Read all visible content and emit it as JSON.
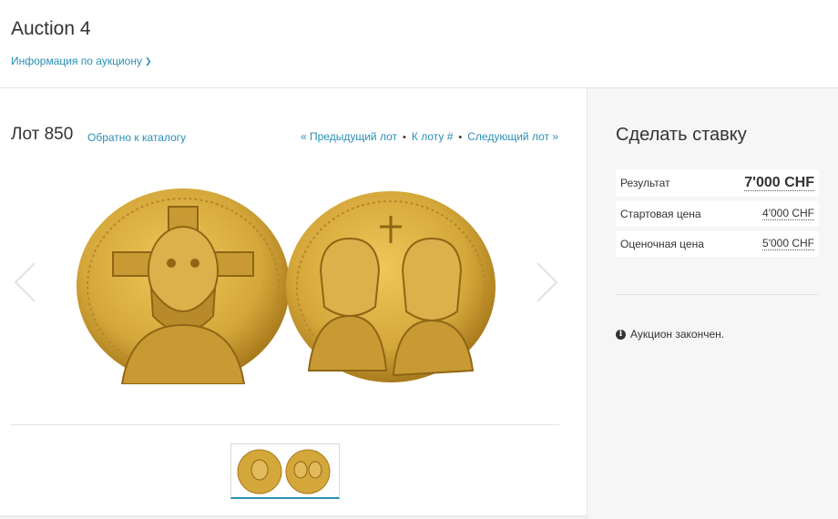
{
  "header": {
    "title": "Auction 4",
    "info_link": "Информация по аукциону"
  },
  "lot": {
    "label": "Лот 850",
    "back_link": "Обратно к каталогу",
    "prev_link": "« Предыдущий лот",
    "goto_link": "К лоту #",
    "next_link": "Следующий лот »",
    "separator": "•"
  },
  "bid": {
    "title": "Сделать ставку",
    "rows": [
      {
        "label": "Результат",
        "value": "7'000 CHF"
      },
      {
        "label": "Стартовая цена",
        "value": "4'000 CHF"
      },
      {
        "label": "Оценочная цена",
        "value": "5'000 CHF"
      }
    ],
    "status_icon": "info-icon",
    "status": "Аукцион закончен."
  },
  "colors": {
    "link": "#2a8fb5",
    "gold": "#d4a73a",
    "gold_dark": "#a87a1c",
    "sidebar_bg": "#f6f6f6"
  }
}
